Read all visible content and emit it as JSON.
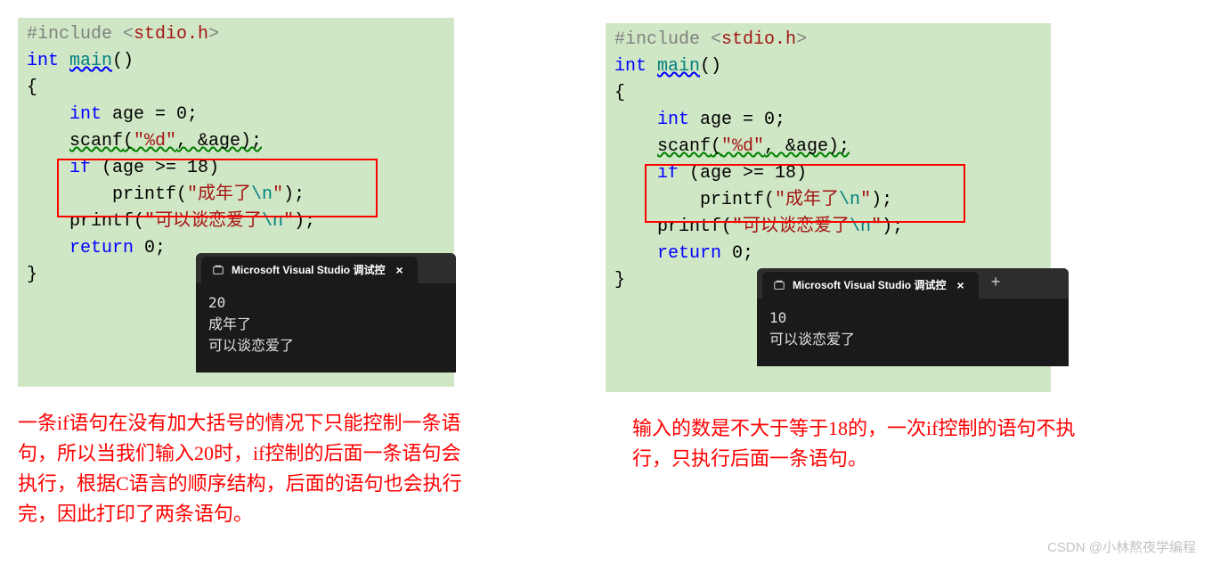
{
  "left": {
    "code": {
      "include_pre": "#include ",
      "include_open": "<",
      "include_hdr": "stdio.h",
      "include_close": ">",
      "int": "int",
      "main": "main",
      "parens": "()",
      "brace_open": "{",
      "decl_int": "int",
      "decl_name": " age = ",
      "decl_zero": "0",
      "decl_semi": ";",
      "scanf": "scanf",
      "scanf_open": "(",
      "scanf_fmt": "\"%d\"",
      "scanf_comma": ", &age);",
      "if": "if",
      "if_cond_open": " (age >= ",
      "if_num": "18",
      "if_cond_close": ")",
      "printf1": "printf",
      "p1_open": "(",
      "p1_str1": "\"成年了",
      "p1_nl": "\\n",
      "p1_str2": "\"",
      "p1_close": ");",
      "printf2": "printf",
      "p2_open": "(",
      "p2_str1": "\"可以谈恋爱了",
      "p2_nl": "\\n",
      "p2_str2": "\"",
      "p2_close": ");",
      "return": "return",
      "return_val": " 0",
      "return_semi": ";",
      "brace_close": "}"
    },
    "terminal": {
      "title": "Microsoft Visual Studio 调试控",
      "close": "×",
      "out_line1": "20",
      "out_line2": "成年了",
      "out_line3": "可以谈恋爱了"
    },
    "annotation": "一条if语句在没有加大括号的情况下只能控制一条语句，所以当我们输入20时，if控制的后面一条语句会执行，根据C语言的顺序结构，后面的语句也会执行完，因此打印了两条语句。"
  },
  "right": {
    "code": {
      "include_pre": "#include ",
      "include_open": "<",
      "include_hdr": "stdio.h",
      "include_close": ">",
      "int": "int",
      "main": "main",
      "parens": "()",
      "brace_open": "{",
      "decl_int": "int",
      "decl_name": " age = ",
      "decl_zero": "0",
      "decl_semi": ";",
      "scanf": "scanf",
      "scanf_open": "(",
      "scanf_fmt": "\"%d\"",
      "scanf_comma": ", &age);",
      "if": "if",
      "if_cond_open": " (age >= ",
      "if_num": "18",
      "if_cond_close": ")",
      "printf1": "printf",
      "p1_open": "(",
      "p1_str1": "\"成年了",
      "p1_nl": "\\n",
      "p1_str2": "\"",
      "p1_close": ");",
      "printf2": "printf",
      "p2_open": "(",
      "p2_str1": "\"可以谈恋爱了",
      "p2_nl": "\\n",
      "p2_str2": "\"",
      "p2_close": ");",
      "return": "return",
      "return_val": " 0",
      "return_semi": ";",
      "brace_close": "}"
    },
    "terminal": {
      "title": "Microsoft Visual Studio 调试控",
      "close": "×",
      "plus": "+",
      "out_line1": "10",
      "out_line2": "可以谈恋爱了"
    },
    "annotation": "输入的数是不大于等于18的，一次if控制的语句不执行，只执行后面一条语句。"
  },
  "watermark": "CSDN @小林熬夜学编程"
}
